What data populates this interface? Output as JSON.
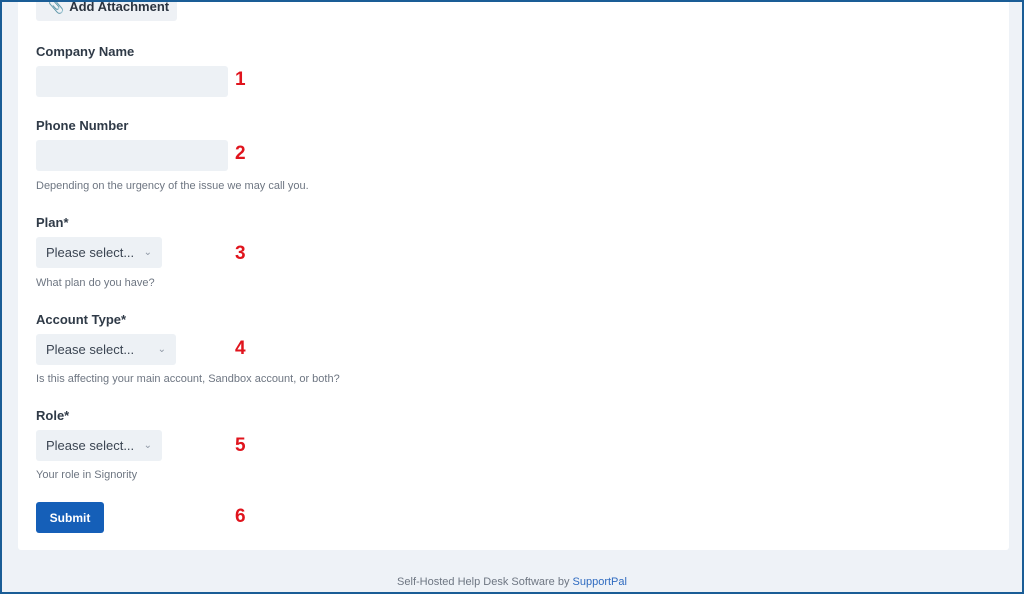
{
  "form": {
    "attachment_button": "Add Attachment",
    "company_name": {
      "label": "Company Name",
      "value": ""
    },
    "phone_number": {
      "label": "Phone Number",
      "value": "",
      "help": "Depending on the urgency of the issue we may call you."
    },
    "plan": {
      "label": "Plan*",
      "selected": "Please select...",
      "help": "What plan do you have?"
    },
    "account_type": {
      "label": "Account Type*",
      "selected": "Please select...",
      "help": "Is this affecting your main account, Sandbox account, or both?"
    },
    "role": {
      "label": "Role*",
      "selected": "Please select...",
      "help": "Your role in Signority"
    },
    "submit": "Submit"
  },
  "annotations": [
    "1",
    "2",
    "3",
    "4",
    "5",
    "6"
  ],
  "footer": {
    "text": "Self-Hosted Help Desk Software by ",
    "link": "SupportPal"
  },
  "colors": {
    "accent": "#155fb8",
    "annotation": "#e0141d",
    "frame": "#1a5d96"
  }
}
